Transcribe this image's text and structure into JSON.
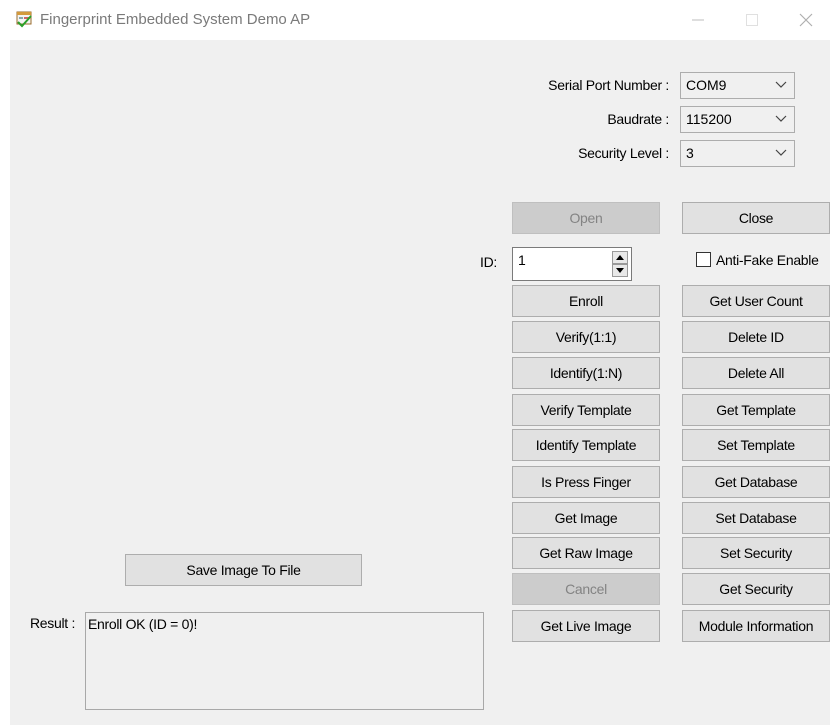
{
  "window": {
    "title": "Fingerprint Embedded System Demo AP",
    "icon": "fingerprint-app-icon",
    "controls": [
      "minimize-icon",
      "maximize-icon",
      "close-icon"
    ]
  },
  "settings": {
    "serial_port": {
      "label": "Serial Port Number :",
      "value": "COM9"
    },
    "baudrate": {
      "label": "Baudrate :",
      "value": "115200"
    },
    "security_level": {
      "label": "Security Level :",
      "value": "3"
    }
  },
  "connection": {
    "open": {
      "label": "Open",
      "enabled": false
    },
    "close": {
      "label": "Close",
      "enabled": true
    }
  },
  "id_field": {
    "label": "ID:",
    "value": "1"
  },
  "anti_fake": {
    "label": "Anti-Fake Enable",
    "checked": false
  },
  "buttons_left": [
    {
      "label": "Enroll",
      "enabled": true
    },
    {
      "label": "Verify(1:1)",
      "enabled": true
    },
    {
      "label": "Identify(1:N)",
      "enabled": true
    },
    {
      "label": "Verify Template",
      "enabled": true
    },
    {
      "label": "Identify Template",
      "enabled": true
    },
    {
      "label": "Is Press Finger",
      "enabled": true
    },
    {
      "label": "Get Image",
      "enabled": true
    },
    {
      "label": "Get Raw Image",
      "enabled": true
    },
    {
      "label": "Cancel",
      "enabled": false
    },
    {
      "label": "Get Live Image",
      "enabled": true
    }
  ],
  "buttons_right": [
    {
      "label": "Get User Count"
    },
    {
      "label": "Delete ID"
    },
    {
      "label": "Delete All"
    },
    {
      "label": "Get Template"
    },
    {
      "label": "Set Template"
    },
    {
      "label": "Get Database"
    },
    {
      "label": "Set Database"
    },
    {
      "label": "Set Security"
    },
    {
      "label": "Get Security"
    },
    {
      "label": "Module Information"
    }
  ],
  "save_image": {
    "label": "Save Image To File"
  },
  "result": {
    "label": "Result :",
    "text": "Enroll OK (ID = 0)!"
  }
}
